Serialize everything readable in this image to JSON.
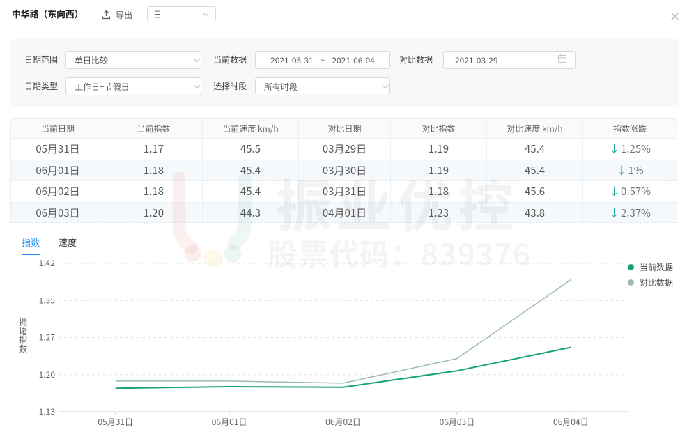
{
  "header": {
    "title": "中华路（东向西）",
    "export_label": "导出",
    "granularity_value": "日"
  },
  "filters": {
    "date_range_label": "日期范围",
    "date_range_value": "单日比较",
    "current_data_label": "当前数据",
    "current_start": "2021-05-31",
    "range_separator": "~",
    "current_end": "2021-06-04",
    "compare_data_label": "对比数据",
    "compare_date": "2021-03-29",
    "date_type_label": "日期类型",
    "date_type_value": "工作日+节假日",
    "time_period_label": "选择时段",
    "time_period_value": "所有时段"
  },
  "table": {
    "headers": [
      "当前日期",
      "当前指数",
      "当前速度 km/h",
      "对比日期",
      "对比指数",
      "对比速度 km/h",
      "指数涨跌"
    ],
    "rows": [
      {
        "current_date": "05月31日",
        "current_index": "1.17",
        "current_speed": "45.5",
        "compare_date": "03月29日",
        "compare_index": "1.19",
        "compare_speed": "45.4",
        "change_arrow": "↓",
        "change": "1.25%",
        "direction": "down"
      },
      {
        "current_date": "06月01日",
        "current_index": "1.18",
        "current_speed": "45.4",
        "compare_date": "03月30日",
        "compare_index": "1.19",
        "compare_speed": "45.4",
        "change_arrow": "↓",
        "change": "1%",
        "direction": "down"
      },
      {
        "current_date": "06月02日",
        "current_index": "1.18",
        "current_speed": "45.4",
        "compare_date": "03月31日",
        "compare_index": "1.18",
        "compare_speed": "45.6",
        "change_arrow": "↓",
        "change": "0.57%",
        "direction": "down"
      },
      {
        "current_date": "06月03日",
        "current_index": "1.20",
        "current_speed": "44.3",
        "compare_date": "04月01日",
        "compare_index": "1.23",
        "compare_speed": "43.8",
        "change_arrow": "↓",
        "change": "2.37%",
        "direction": "down"
      }
    ]
  },
  "tabs": [
    {
      "label": "指数",
      "active": true
    },
    {
      "label": "速度",
      "active": false
    }
  ],
  "watermark": {
    "line1": "振业优控",
    "line2": "股票代码：839376"
  },
  "chart_data": {
    "type": "line",
    "categories": [
      "05月31日",
      "06月01日",
      "06月02日",
      "06月03日",
      "06月04日"
    ],
    "series": [
      {
        "name": "当前数据",
        "color": "#17a179",
        "width": 2,
        "values": [
          1.176,
          1.179,
          1.178,
          1.21,
          1.256
        ]
      },
      {
        "name": "对比数据",
        "color": "#9cbbad",
        "width": 1.5,
        "values": [
          1.19,
          1.19,
          1.186,
          1.234,
          1.388
        ]
      }
    ],
    "title": "",
    "xlabel": "",
    "ylabel": "拥堵指数",
    "ylim": [
      1.13,
      1.42
    ],
    "ytick_labels": [
      "1.13",
      "1.20",
      "1.27",
      "1.35",
      "1.42"
    ],
    "grid": "dashed-horizontal",
    "legend_position": "right"
  },
  "colors": {
    "accent_blue": "#1890ff",
    "line_current": "#17a179",
    "line_compare": "#9cbbad",
    "arrow_down": "#29a79e",
    "axis_label": "#666666",
    "panel_bg": "#f7f8fa"
  }
}
